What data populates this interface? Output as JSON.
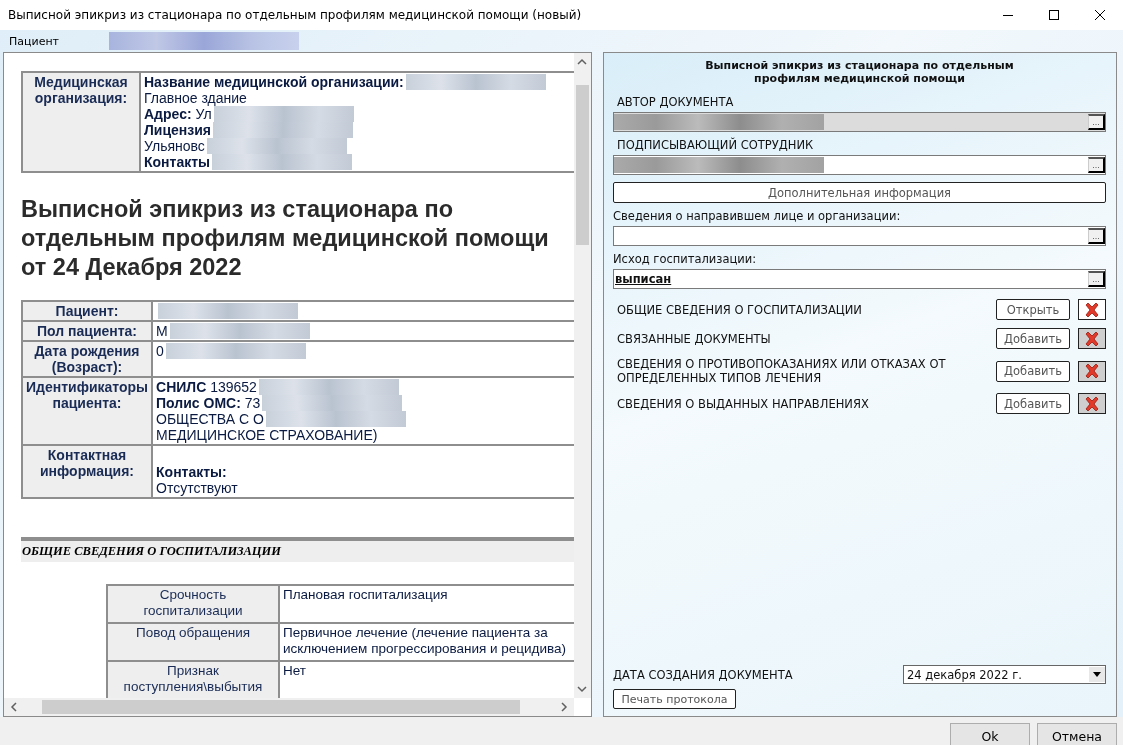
{
  "window": {
    "title": "Выписной эпикриз из стационара по отдельным профилям медицинской помощи (новый)"
  },
  "patient": {
    "label": "Пациент",
    "redacted": true
  },
  "document": {
    "org_table": {
      "label": "Медицинская организация:",
      "lines": [
        {
          "text": "**Название медицинской организации:**",
          "redacted": true
        },
        {
          "text": "Главное здание",
          "redacted": false
        },
        {
          "text": "**Адрес:** Ул",
          "redacted": true
        },
        {
          "text": "**Лицензия**",
          "redacted": true
        },
        {
          "text": "Ульяновс",
          "redacted": true
        },
        {
          "text": "**Контакты**",
          "redacted": true
        }
      ]
    },
    "heading": "Выписной эпикриз из стационара по отдельным профилям медицинской помощи от 24 Декабря 2022",
    "patient_table": [
      {
        "label": "Пациент:",
        "lines": [
          {
            "redacted": true
          }
        ]
      },
      {
        "label": "Пол пациента:",
        "lines": [
          {
            "text": "М",
            "redacted": true
          }
        ]
      },
      {
        "label": "Дата рождения (Возраст):",
        "lines": [
          {
            "text": "0",
            "redacted": true
          }
        ]
      },
      {
        "label": "Идентификаторы пациента:",
        "lines": [
          {
            "text": "**СНИЛС** 139652",
            "redacted": true
          },
          {
            "text": "**Полис ОМС:** 73",
            "redacted": true
          },
          {
            "text": "ОБЩЕСТВА С О",
            "redacted": true
          },
          {
            "text": "МЕДИЦИНСКОЕ СТРАХОВАНИЕ)",
            "redacted": false
          }
        ]
      },
      {
        "label": "Контактная информация:",
        "lines": [
          {
            "text": "**Контакты:**",
            "redacted": false
          },
          {
            "text": "Отсутствуют",
            "redacted": false
          }
        ]
      }
    ],
    "section_title": "ОБЩИЕ СВЕДЕНИЯ О ГОСПИТАЛИЗАЦИИ",
    "hosp_table": [
      {
        "label": "Срочность госпитализации",
        "value": "Плановая госпитализация"
      },
      {
        "label": "Повод обращения",
        "value": "Первичное лечение (лечение пациента за исключением прогрессирования и рецидива)"
      },
      {
        "label": "Признак поступления\\выбытия",
        "value": "Нет"
      }
    ]
  },
  "form": {
    "title": "Выписной эпикриз из стационара по отдельным профилям медицинской помощи",
    "fields": [
      {
        "kind": "caps",
        "label": "АВТОР ДОКУМЕНТА",
        "redacted": true,
        "readonly": true,
        "button": "..."
      },
      {
        "kind": "caps",
        "label": "ПОДПИСЫВАЮЩИЙ СОТРУДНИК",
        "redacted": true,
        "readonly": false,
        "button": "..."
      },
      {
        "kind": "button",
        "label": "Дополнительная информация"
      },
      {
        "kind": "plain",
        "label": "Сведения о направившем лице и организации:",
        "readonly": false,
        "button": "..."
      },
      {
        "kind": "plain",
        "label": "Исход госпитализации:",
        "value": "выписан",
        "readonly": false,
        "button": "..."
      }
    ],
    "sections": [
      {
        "label": "ОБЩИЕ СВЕДЕНИЯ О ГОСПИТАЛИЗАЦИИ",
        "button": "Открыть",
        "delete_disabled": false
      },
      {
        "label": "СВЯЗАННЫЕ ДОКУМЕНТЫ",
        "button": "Добавить",
        "delete_disabled": true
      },
      {
        "label": "СВЕДЕНИЯ О ПРОТИВОПОКАЗАНИЯХ ИЛИ ОТКАЗАХ ОТ ОПРЕДЕЛЕННЫХ ТИПОВ ЛЕЧЕНИЯ",
        "button": "Добавить",
        "delete_disabled": true
      },
      {
        "label": "СВЕДЕНИЯ О ВЫДАННЫХ НАПРАВЛЕНИЯХ",
        "button": "Добавить",
        "delete_disabled": true
      }
    ],
    "date_label": "ДАТА СОЗДАНИЯ ДОКУМЕНТА",
    "date_value": "24  декабря  2022 г.",
    "print_button": "Печать протокола"
  },
  "buttons": [
    "Ok",
    "Отмена"
  ]
}
